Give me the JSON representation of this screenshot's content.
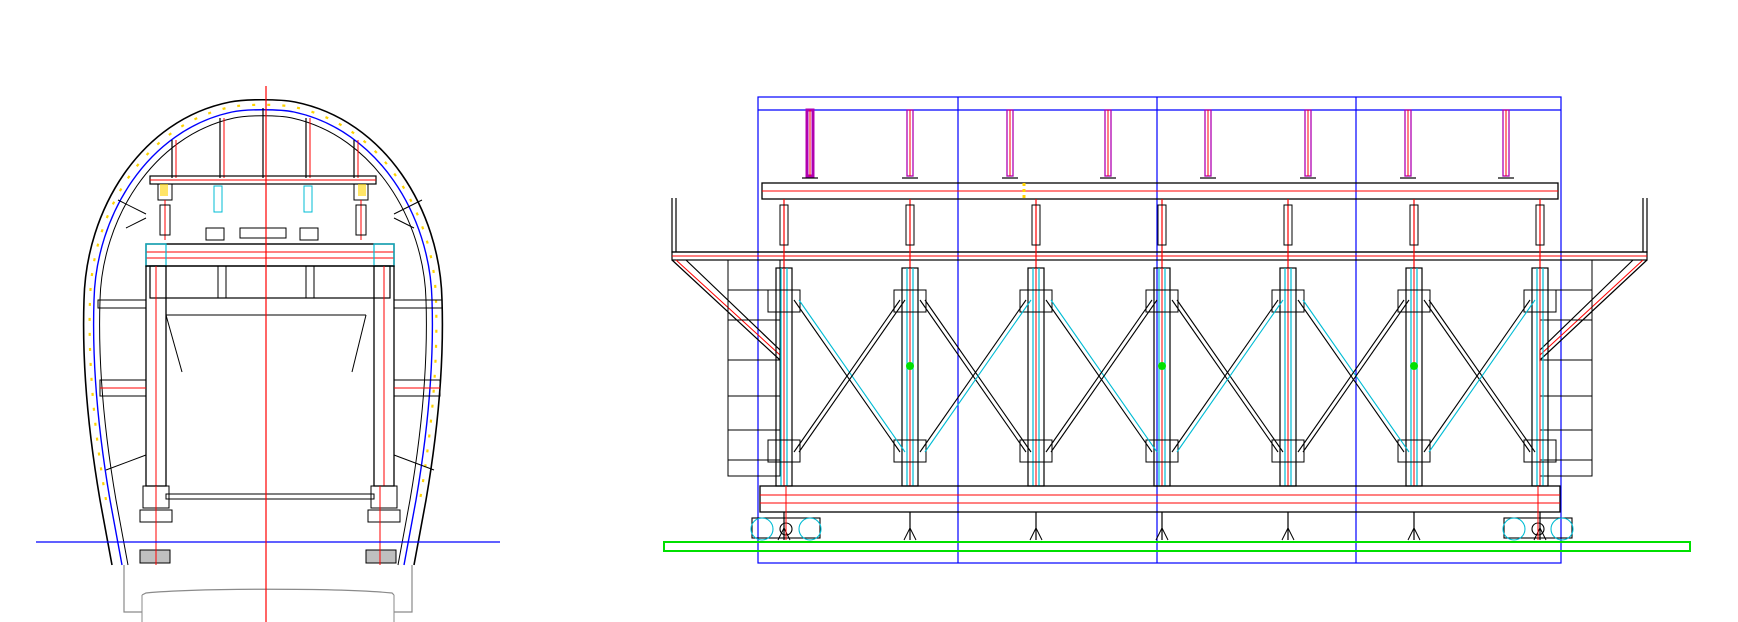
{
  "drawing": {
    "views": [
      {
        "id": "cross-section",
        "label": ""
      },
      {
        "id": "side-elevation",
        "label": ""
      }
    ],
    "colors": {
      "background": "#ffffff",
      "structure": "#000000",
      "centerline": "#ff0000",
      "frame": "#0000ff",
      "accent_cyan": "#00bcd4",
      "ground": "#00e000",
      "marker_yellow": "#ffd400",
      "jack_magenta": "#b000b0",
      "outline_gray": "#8a8a8a"
    },
    "icons": [
      "wheel-icon",
      "screw-jack-icon",
      "hydraulic-cylinder-icon"
    ]
  }
}
